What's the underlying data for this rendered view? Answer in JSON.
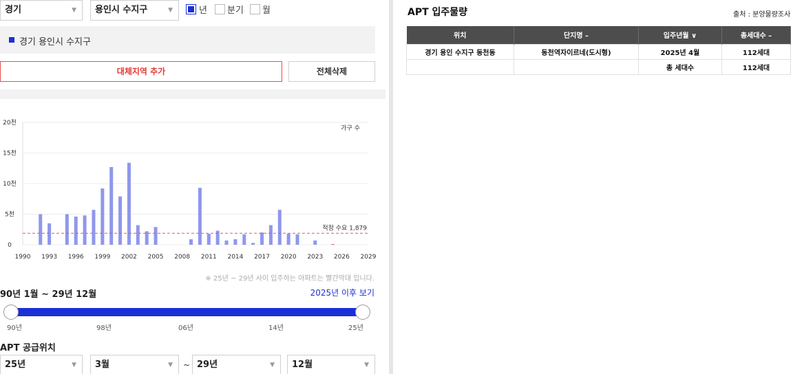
{
  "filters": {
    "province": "경기",
    "city": "용인시 수지구",
    "period_options": [
      {
        "label": "년",
        "checked": true
      },
      {
        "label": "분기",
        "checked": false
      },
      {
        "label": "월",
        "checked": false
      }
    ]
  },
  "region_item": "경기 용인시 수지구",
  "buttons": {
    "add_region": "대체지역 추가",
    "clear_all": "전체삭제"
  },
  "chart_data": {
    "type": "bar",
    "title": "",
    "legend": "가구 수",
    "x": [
      1992,
      1993,
      1995,
      1996,
      1997,
      1998,
      1999,
      2000,
      2001,
      2002,
      2003,
      2004,
      2005,
      2006,
      2007,
      2009,
      2010,
      2011,
      2012,
      2013,
      2014,
      2015,
      2016,
      2017,
      2018,
      2019,
      2020,
      2021,
      2023,
      2025
    ],
    "values": [
      5000,
      3500,
      5000,
      4600,
      4800,
      5700,
      9200,
      12700,
      7900,
      13400,
      3200,
      2200,
      2900,
      0,
      0,
      900,
      9300,
      1800,
      2300,
      700,
      900,
      1700,
      300,
      2000,
      3200,
      5700,
      1800,
      1700,
      700,
      112
    ],
    "highlight_from": 2025,
    "xlim": [
      1990,
      2029
    ],
    "ylim": [
      0,
      20000
    ],
    "y_ticks": [
      "0",
      "5천",
      "10천",
      "15천",
      "20천"
    ],
    "x_ticks": [
      "1990",
      "1993",
      "1996",
      "1999",
      "2002",
      "2005",
      "2008",
      "2011",
      "2014",
      "2017",
      "2020",
      "2023",
      "2026",
      "2029"
    ],
    "reference_line": {
      "value": 1879,
      "label": "적정 수요 1,879"
    }
  },
  "note": "※ 25년 ~ 29년 사이 입주하는 아파트는 빨간막대 입니다.",
  "range_title": "90년 1월 ~ 29년 12월",
  "view_after_link": "2025년 이후 보기",
  "slider": {
    "labels": [
      "90년",
      "98년",
      "06년",
      "14년",
      "25년"
    ],
    "min": 1990,
    "max": 2025
  },
  "supply_title": "APT 공급위치",
  "supply_filters": {
    "from_year": "25년",
    "from_month": "3월",
    "tilde": "~",
    "to_year": "29년",
    "to_month": "12월"
  },
  "apt": {
    "title": "APT 입주물량",
    "source": "출처 : 분양물량조사",
    "headers": [
      "위치",
      "단지명 –",
      "입주년월 ∨",
      "총세대수 –"
    ],
    "rows": [
      [
        "경기 용인 수지구 동천동",
        "동천역자이르네(도시형)",
        "2025년 4월",
        "112세대"
      ],
      [
        "",
        "",
        "총 세대수",
        "112세대"
      ]
    ]
  }
}
